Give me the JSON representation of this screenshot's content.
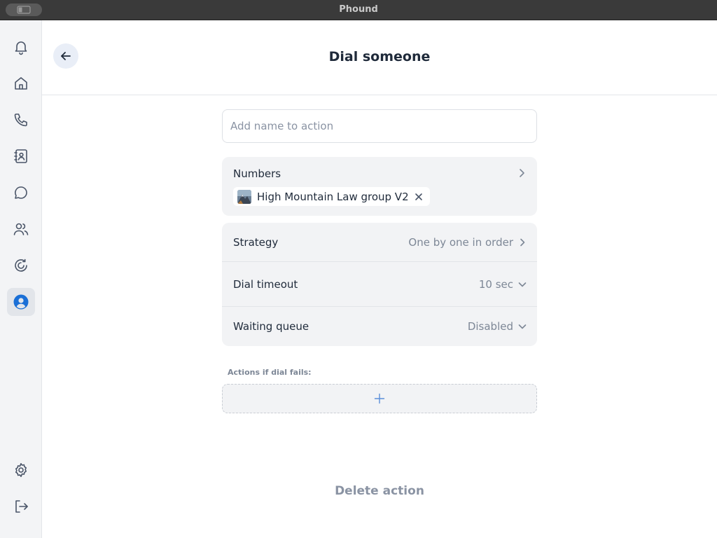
{
  "window": {
    "title": "Phound"
  },
  "sidebar": {
    "items": [
      {
        "icon": "bell-icon",
        "name": "sidebar-item-notifications"
      },
      {
        "icon": "home-icon",
        "name": "sidebar-item-home"
      },
      {
        "icon": "phone-icon",
        "name": "sidebar-item-calls"
      },
      {
        "icon": "contacts-icon",
        "name": "sidebar-item-contacts"
      },
      {
        "icon": "chat-icon",
        "name": "sidebar-item-chats"
      },
      {
        "icon": "users-icon",
        "name": "sidebar-item-team"
      },
      {
        "icon": "refresh-icon",
        "name": "sidebar-item-activity"
      },
      {
        "icon": "profile-icon",
        "name": "sidebar-item-profile",
        "active": true
      }
    ],
    "bottom": [
      {
        "icon": "gear-icon",
        "name": "sidebar-item-settings"
      },
      {
        "icon": "logout-icon",
        "name": "sidebar-item-logout"
      }
    ]
  },
  "header": {
    "title": "Dial someone"
  },
  "form": {
    "name_placeholder": "Add name to action",
    "numbers": {
      "label": "Numbers",
      "chips": [
        {
          "label": "High Mountain Law group V2"
        }
      ]
    },
    "strategy": {
      "label": "Strategy",
      "value": "One by one in order"
    },
    "dial_timeout": {
      "label": "Dial timeout",
      "value": "10 sec"
    },
    "waiting_queue": {
      "label": "Waiting queue",
      "value": "Disabled"
    },
    "fails_label": "Actions if dial fails:",
    "delete_label": "Delete action"
  },
  "colors": {
    "accent": "#1a6fd6",
    "icon": "#4a5568",
    "card_bg": "#f2f3f5",
    "muted_text": "#7d8796"
  }
}
